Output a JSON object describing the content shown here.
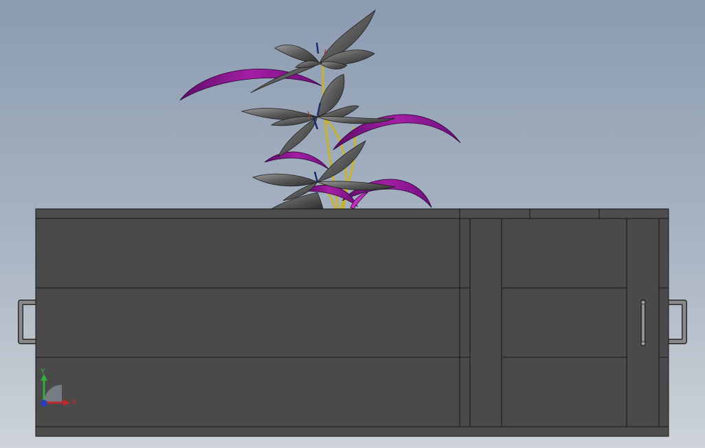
{
  "viewport": {
    "background_top": "#8b9bb0",
    "background_bottom": "#cdd3d9"
  },
  "model": {
    "box_color": "#4a4a4a",
    "box_edge_color": "#161616",
    "leaf_color": "#8c1a8c",
    "petal_color": "#5e5e5e",
    "stem_color": "#c8b32a",
    "stamen_color": "#1c2a6e",
    "handle_color": "#7a7a7a"
  },
  "triad": {
    "x_label": "X",
    "y_label": "Y",
    "x_color": "#c0282a",
    "y_color": "#2fae3a",
    "z_color": "#2a3eb8",
    "icon": "coordinate-triad-icon"
  }
}
